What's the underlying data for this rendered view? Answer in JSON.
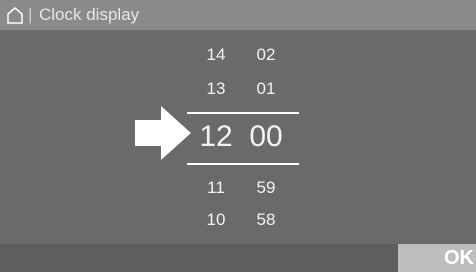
{
  "header": {
    "separator": "|",
    "title": "Clock display",
    "home_icon": "home-icon"
  },
  "picker": {
    "rows": [
      {
        "hour": "14",
        "minute": "02"
      },
      {
        "hour": "13",
        "minute": "01"
      },
      {
        "hour": "12",
        "minute": "00"
      },
      {
        "hour": "11",
        "minute": "59"
      },
      {
        "hour": "10",
        "minute": "58"
      }
    ],
    "selected_index": 2,
    "pointer_icon": "right-arrow-icon"
  },
  "footer": {
    "ok_label": "OK"
  },
  "colors": {
    "background": "#6a6a6a",
    "header": "#8a8a8a",
    "ok_button": "#bdbdbd",
    "text": "#ffffff"
  }
}
